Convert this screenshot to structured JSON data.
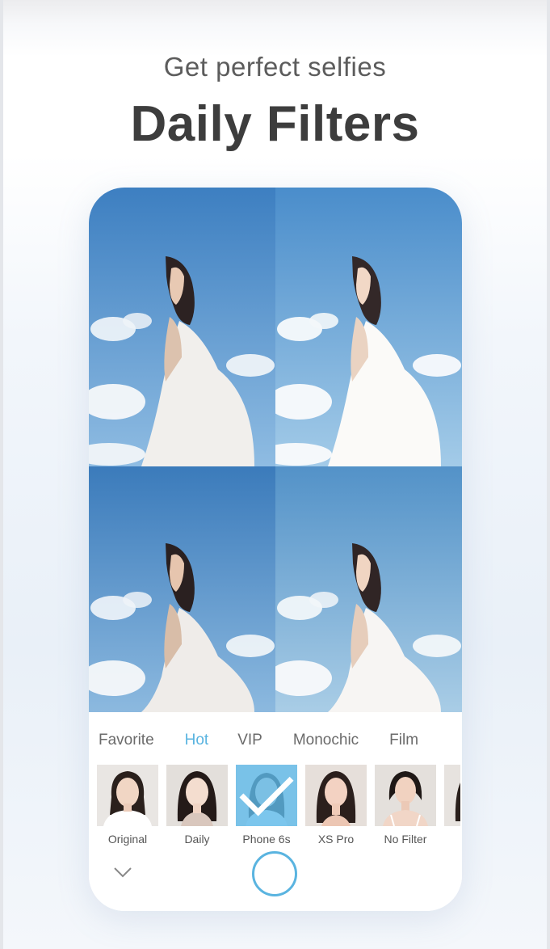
{
  "header": {
    "subtitle": "Get perfect selfies",
    "title": "Daily Filters"
  },
  "tabs": [
    {
      "label": "Favorite",
      "active": false
    },
    {
      "label": "Hot",
      "active": true
    },
    {
      "label": "VIP",
      "active": false
    },
    {
      "label": "Monochic",
      "active": false
    },
    {
      "label": "Film",
      "active": false
    }
  ],
  "filters": [
    {
      "label": "Original",
      "selected": false
    },
    {
      "label": "Daily",
      "selected": false
    },
    {
      "label": "Phone 6s",
      "selected": true
    },
    {
      "label": "XS Pro",
      "selected": false
    },
    {
      "label": "No Filter",
      "selected": false
    }
  ],
  "icons": {
    "collapse": "chevron-down-icon",
    "shutter": "shutter-icon",
    "check": "check-icon"
  },
  "colors": {
    "accent": "#5ab4e0",
    "title": "#3d3d3d",
    "subtitle": "#5c5c5c",
    "sky": "#4f8fc9"
  }
}
